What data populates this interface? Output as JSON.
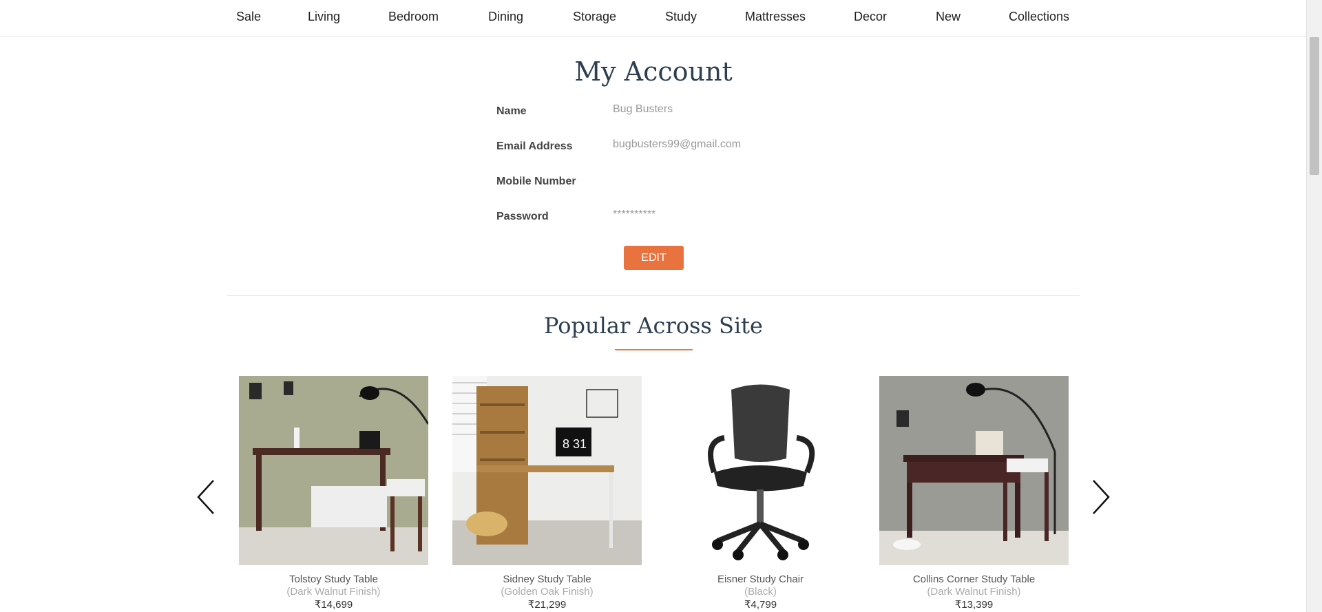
{
  "nav": {
    "items": [
      "Sale",
      "Living",
      "Bedroom",
      "Dining",
      "Storage",
      "Study",
      "Mattresses",
      "Decor",
      "New",
      "Collections"
    ]
  },
  "account": {
    "title": "My Account",
    "fields": [
      {
        "label": "Name",
        "value": "Bug Busters"
      },
      {
        "label": "Email Address",
        "value": "bugbusters99@gmail.com"
      },
      {
        "label": "Mobile Number",
        "value": ""
      },
      {
        "label": "Password",
        "value": "**********"
      }
    ],
    "edit_label": "EDIT"
  },
  "popular": {
    "title": "Popular Across Site",
    "products": [
      {
        "name": "Tolstoy Study Table",
        "finish": "(Dark Walnut Finish)",
        "price": "₹14,699"
      },
      {
        "name": "Sidney Study Table",
        "finish": "(Golden Oak Finish)",
        "price": "₹21,299"
      },
      {
        "name": "Eisner Study Chair",
        "finish": "(Black)",
        "price": "₹4,799"
      },
      {
        "name": "Collins Corner Study Table",
        "finish": "(Dark Walnut Finish)",
        "price": "₹13,399"
      }
    ]
  },
  "icons": {
    "prev": "chevron-left-icon",
    "next": "chevron-right-icon"
  },
  "colors": {
    "accent": "#e8733f",
    "heading": "#2c3e50"
  }
}
